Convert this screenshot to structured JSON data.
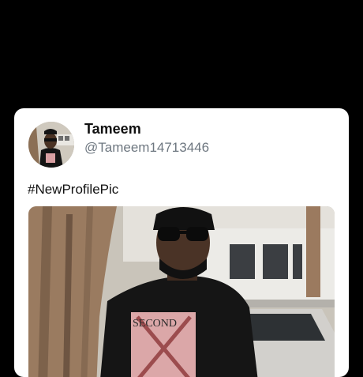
{
  "tweet": {
    "author_name": "Tameem",
    "author_handle": "@Tameem14713446",
    "text": "#NewProfilePic",
    "shirt_print": "SECOND"
  },
  "icons": {
    "avatar": "profile-photo",
    "media": "profile-photo-large"
  },
  "colors": {
    "background": "#000000",
    "card": "#ffffff",
    "name": "#111111",
    "handle": "#6e7780"
  }
}
